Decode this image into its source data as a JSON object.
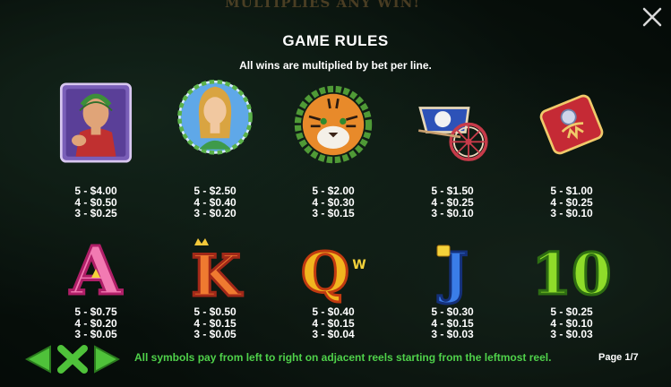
{
  "header": {
    "banner": "MULTIPLIES ANY WIN!",
    "title": "GAME RULES",
    "subtitle": "All wins are multiplied by bet per line."
  },
  "symbols": [
    {
      "name": "caesar",
      "pays": [
        "5 - $4.00",
        "4 - $0.50",
        "3 - $0.25"
      ]
    },
    {
      "name": "goddess",
      "pays": [
        "5 - $2.50",
        "4 - $0.40",
        "3 - $0.20"
      ]
    },
    {
      "name": "tiger",
      "pays": [
        "5 - $2.00",
        "4 - $0.30",
        "3 - $0.15"
      ]
    },
    {
      "name": "chariot",
      "pays": [
        "5 - $1.50",
        "4 - $0.25",
        "3 - $0.10"
      ]
    },
    {
      "name": "shield",
      "pays": [
        "5 - $1.00",
        "4 - $0.25",
        "3 - $0.10"
      ]
    },
    {
      "name": "A",
      "pays": [
        "5 - $0.75",
        "4 - $0.20",
        "3 - $0.05"
      ]
    },
    {
      "name": "K",
      "pays": [
        "5 - $0.50",
        "4 - $0.15",
        "3 - $0.05"
      ]
    },
    {
      "name": "Q",
      "pays": [
        "5 - $0.40",
        "4 - $0.15",
        "3 - $0.04"
      ]
    },
    {
      "name": "J",
      "pays": [
        "5 - $0.30",
        "4 - $0.15",
        "3 - $0.03"
      ]
    },
    {
      "name": "10",
      "pays": [
        "5 - $0.25",
        "4 - $0.10",
        "3 - $0.03"
      ]
    }
  ],
  "footer": {
    "rule": "All symbols pay from left to right on adjacent reels starting from the leftmost reel.",
    "page": "Page 1/7"
  },
  "letters": {
    "A": "A",
    "K": "K",
    "Q": "Q",
    "J": "J",
    "ten": "10",
    "w": "W"
  },
  "colors": {
    "accent_green": "#4fd14a",
    "text": "#ffffff"
  }
}
